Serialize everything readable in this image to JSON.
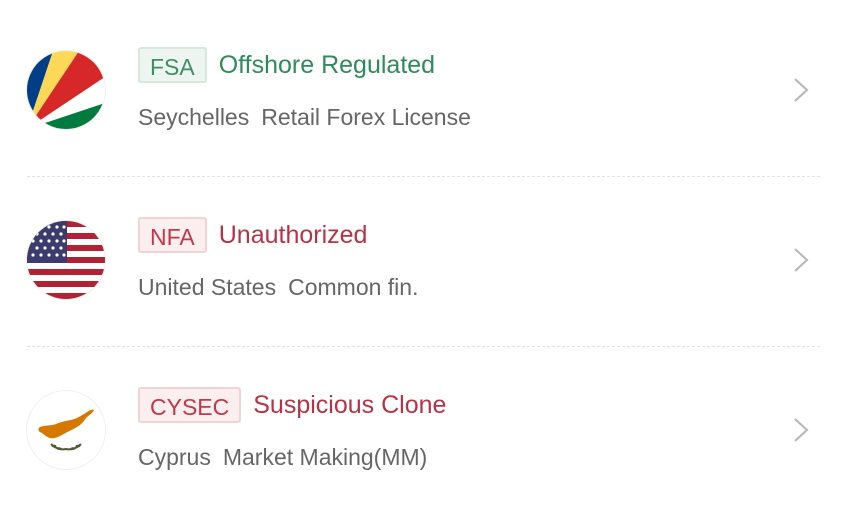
{
  "regulators": [
    {
      "flag_icon": "seychelles-flag-icon",
      "badge": "FSA",
      "status": "Offshore Regulated",
      "status_color": "#2f8a5c",
      "country": "Seychelles",
      "license": "Retail Forex License"
    },
    {
      "flag_icon": "united-states-flag-icon",
      "badge": "NFA",
      "status": "Unauthorized",
      "status_color": "#b83246",
      "country": "United States",
      "license": "Common fin."
    },
    {
      "flag_icon": "cyprus-flag-icon",
      "badge": "CYSEC",
      "status": "Suspicious Clone",
      "status_color": "#b83246",
      "country": "Cyprus",
      "license": "Market Making(MM)"
    }
  ],
  "colors": {
    "regulated_green": "#2f8a5c",
    "warning_red": "#b83246",
    "secondary_text": "#666666",
    "chevron": "#b5b5b5"
  }
}
